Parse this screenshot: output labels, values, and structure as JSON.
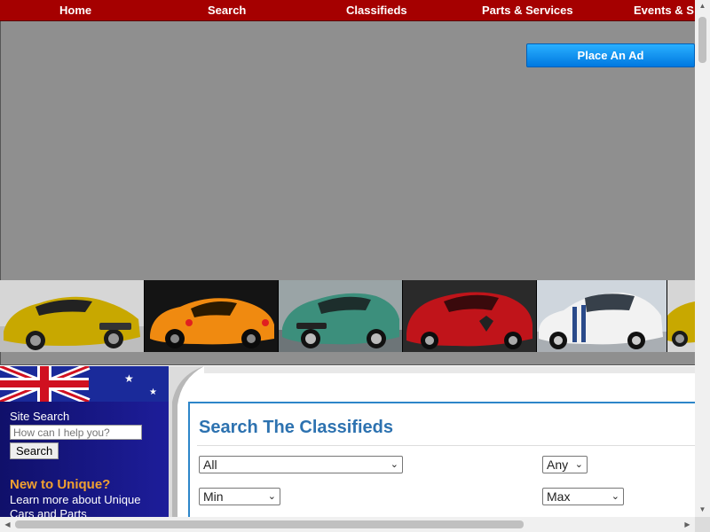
{
  "nav": {
    "items": [
      "Home",
      "Search",
      "Classifieds",
      "Parts & Services",
      "Events & S"
    ]
  },
  "banner": {
    "place_ad": "Place An Ad"
  },
  "car_strip": {
    "cars": [
      "yellow-aston-martin",
      "orange-lotus-elise",
      "green-aston-martin",
      "red-alfa-romeo",
      "white-mustang-shelby",
      "yellow-aston-martin"
    ]
  },
  "sidebar": {
    "site_search_label": "Site Search",
    "search_placeholder": "How can I help you?",
    "search_button": "Search",
    "new_title": "New to Unique?",
    "new_text": "Learn more about Unique Cars and Parts"
  },
  "search_panel": {
    "title": "Search The Classifieds",
    "make_select": "All",
    "year_select": "Any",
    "min_select": "Min",
    "max_select": "Max"
  },
  "colors": {
    "nav_bg": "#a50000",
    "banner_bg": "#8f8f8f",
    "accent_blue": "#2d86c9",
    "ad_button": "#0a8ff0",
    "sidebar_bg": "#10106a",
    "new_title": "#f0a030"
  }
}
